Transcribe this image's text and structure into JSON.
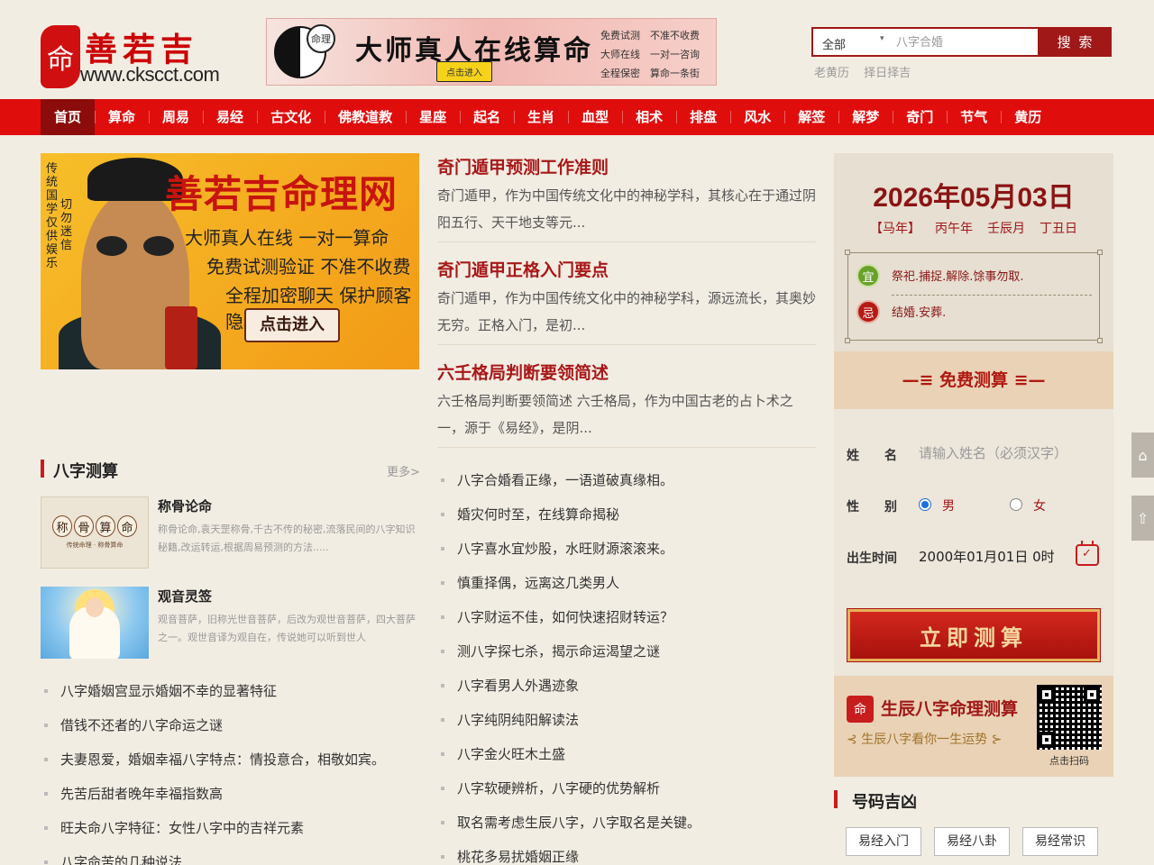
{
  "site": {
    "seal_char": "命",
    "name": "善若吉",
    "url": "www.ckscct.com"
  },
  "top_banner": {
    "stamp": "命理",
    "title": "大师真人在线算命",
    "button": "点击进入",
    "features": "免费试测　不准不收费\n大师在线　一对一咨询\n全程保密　算命一条街"
  },
  "search": {
    "category": "全部",
    "placeholder": "八字合婚",
    "button": "搜 索",
    "quick_links": [
      "老黄历",
      "择日择吉"
    ]
  },
  "nav": [
    "首页",
    "算命",
    "周易",
    "易经",
    "古文化",
    "佛教道教",
    "星座",
    "起名",
    "生肖",
    "血型",
    "相术",
    "排盘",
    "风水",
    "解签",
    "解梦",
    "奇门",
    "节气",
    "黄历"
  ],
  "hero": {
    "side_text_1": "传统国学仅供娱乐",
    "side_text_2": "切勿迷信",
    "title": "善若吉命理网",
    "line1": "大师真人在线 一对一算命",
    "line2": "免费试测验证 不准不收费",
    "line3": "全程加密聊天 保护顾客隐私",
    "button": "点击进入"
  },
  "bazi_section": {
    "title": "八字测算",
    "more": "更多>",
    "thumb1_chars": [
      "称",
      "骨",
      "算",
      "命"
    ],
    "thumb1_sub": "传统命理 · 称骨算命",
    "cards": [
      {
        "title": "称骨论命",
        "desc": "称骨论命,袁天罡称骨,千古不传的秘密,流落民间的八字知识秘籍,改运转运,根据周易预测的方法....."
      },
      {
        "title": "观音灵签",
        "desc": "观音菩萨，旧称光世音菩萨，后改为观世音菩萨，四大菩萨之一。观世音译为观自在，传说她可以听到世人"
      }
    ],
    "list": [
      "八字婚姻宫显示婚姻不幸的显著特征",
      "借钱不还者的八字命运之谜",
      "夫妻恩爱，婚姻幸福八字特点：情投意合，相敬如宾。",
      "先苦后甜者晚年幸福指数高",
      "旺夫命八字特征：女性八字中的吉祥元素",
      "八字命苦的几种说法"
    ]
  },
  "articles": [
    {
      "title": "奇门遁甲预测工作准则",
      "desc": "奇门遁甲，作为中国传统文化中的神秘学科，其核心在于通过阴阳五行、天干地支等元..."
    },
    {
      "title": "奇门遁甲正格入门要点",
      "desc": "奇门遁甲，作为中国传统文化中的神秘学科，源远流长，其奥妙无穷。正格入门，是初..."
    },
    {
      "title": "六壬格局判断要领简述",
      "desc": "六壬格局判断要领简述 六壬格局，作为中国古老的占卜术之一，源于《易经》，是阴..."
    }
  ],
  "mid_list": [
    "八字合婚看正缘，一语道破真缘相。",
    "婚灾何时至，在线算命揭秘",
    "八字喜水宜炒股，水旺财源滚滚来。",
    "慎重择偶，远离这几类男人",
    "八字财运不佳，如何快速招财转运？",
    "测八字探七杀，揭示命运渴望之谜",
    "八字看男人外遇迹象",
    "八字纯阴纯阳解读法",
    "八字金火旺木土盛",
    "八字软硬辨析，八字硬的优势解析",
    "取名需考虑生辰八字，八字取名是关键。",
    "桃花多易扰婚姻正缘"
  ],
  "calendar": {
    "date": "2026年05月03日",
    "ganzhi": [
      "【马年】",
      "丙午年",
      "壬辰月",
      "丁丑日"
    ],
    "yi_label": "宜",
    "yi": "祭祀.捕捉.解除.馀事勿取.",
    "ji_label": "忌",
    "ji": "结婚.安葬."
  },
  "free_test": {
    "title": "免费测算",
    "left_deco": "—≡",
    "right_deco": "≡—"
  },
  "form": {
    "name_label": "姓　　名",
    "name_placeholder": "请输入姓名（必须汉字）",
    "gender_label": "性　　别",
    "male": "男",
    "female": "女",
    "birth_label": "出生时间",
    "birth_value": "2000年01月01日 0时",
    "submit": "立即测算"
  },
  "promo": {
    "seal": "命",
    "title": "生辰八字命理测算",
    "subtitle": "⊰ 生辰八字看你一生运势 ⊱",
    "qr_label": "点击扫码"
  },
  "number_section": {
    "title": "号码吉凶",
    "tags": [
      "易经入门",
      "易经八卦",
      "易经常识"
    ]
  },
  "float_buttons": [
    "⌂",
    "⇧"
  ],
  "colors": {
    "nav_red": "#e00d0d",
    "nav_active": "#8c0c0c",
    "brand_red": "#a01818",
    "background": "#f2ede3"
  }
}
